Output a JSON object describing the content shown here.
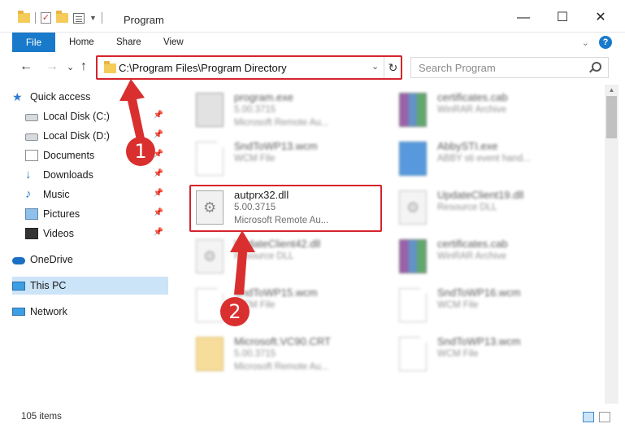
{
  "window": {
    "title": "Program",
    "minimize": "—",
    "maximize": "☐",
    "close": "✕"
  },
  "ribbon": {
    "tabs": [
      "File",
      "Home",
      "Share",
      "View"
    ],
    "collapse": "⌄",
    "help": "?"
  },
  "nav": {
    "back": "←",
    "forward": "→",
    "recent": "⌄",
    "up": "↑"
  },
  "address": {
    "path": "C:\\Program Files\\Program Directory",
    "dropdown": "⌄",
    "refresh": "↻"
  },
  "search": {
    "placeholder": "Search Program"
  },
  "sidebar": {
    "items": [
      {
        "label": "Quick access",
        "icon": "star-icon"
      },
      {
        "label": "Local Disk (C:)",
        "icon": "disk-icon",
        "pinned": true
      },
      {
        "label": "Local Disk (D:)",
        "icon": "disk-icon",
        "pinned": true
      },
      {
        "label": "Documents",
        "icon": "documents-icon",
        "pinned": true
      },
      {
        "label": "Downloads",
        "icon": "download-icon",
        "pinned": true
      },
      {
        "label": "Music",
        "icon": "music-icon",
        "pinned": true
      },
      {
        "label": "Pictures",
        "icon": "pictures-icon",
        "pinned": true
      },
      {
        "label": "Videos",
        "icon": "videos-icon",
        "pinned": true
      },
      {
        "label": "OneDrive",
        "icon": "cloud-icon"
      },
      {
        "label": "This PC",
        "icon": "pc-icon",
        "selected": true
      },
      {
        "label": "Network",
        "icon": "network-icon"
      }
    ]
  },
  "files": [
    {
      "name": "program.exe",
      "line2": "5.00.3715",
      "line3": "Microsoft Remote Au...",
      "icon": "exe-icon"
    },
    {
      "name": "certificates.cab",
      "line2": "WinRAR Archive",
      "line3": "",
      "icon": "rar-icon"
    },
    {
      "name": "SndToWP13.wcm",
      "line2": "WCM File",
      "line3": "",
      "icon": "document-icon"
    },
    {
      "name": "AbbySTI.exe",
      "line2": "ABBY sti event hand...",
      "line3": "",
      "icon": "exe-icon"
    },
    {
      "name": "autprx32.dll",
      "line2": "5.00.3715",
      "line3": "Microsoft Remote Au...",
      "icon": "dll-icon"
    },
    {
      "name": "UpdateClient19.dll",
      "line2": "Resource DLL",
      "line3": "",
      "icon": "dll-icon"
    },
    {
      "name": "UpdateClient42.dll",
      "line2": "Resource DLL",
      "line3": "",
      "icon": "dll-icon"
    },
    {
      "name": "certificates.cab",
      "line2": "WinRAR Archive",
      "line3": "",
      "icon": "rar-icon"
    },
    {
      "name": "SndToWP15.wcm",
      "line2": "WCM File",
      "line3": "",
      "icon": "document-icon"
    },
    {
      "name": "SndToWP16.wcm",
      "line2": "WCM File",
      "line3": "",
      "icon": "document-icon"
    },
    {
      "name": "Microsoft.VC90.CRT",
      "line2": "5.00.3715",
      "line3": "Microsoft Remote Au...",
      "icon": "crt-icon"
    },
    {
      "name": "SndToWP13.wcm",
      "line2": "WCM File",
      "line3": "",
      "icon": "document-icon"
    }
  ],
  "annotations": {
    "step1": "1",
    "step2": "2",
    "color": "#d5242d"
  },
  "status": {
    "count": "105 items"
  },
  "colors": {
    "accent": "#1979ca",
    "selection": "#cce4f7",
    "highlight": "#d5242d"
  }
}
